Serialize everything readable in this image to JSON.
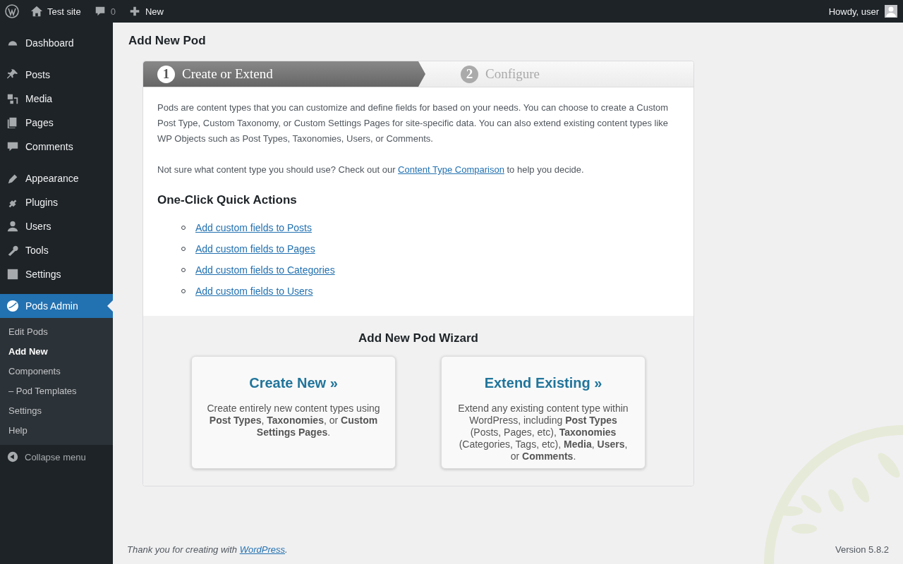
{
  "admin_bar": {
    "site_name": "Test site",
    "comments_count": "0",
    "new_label": "New",
    "greeting": "Howdy, user"
  },
  "sidebar": {
    "groups": [
      [
        {
          "label": "Dashboard",
          "selected": false
        }
      ],
      [
        {
          "label": "Posts",
          "selected": false
        },
        {
          "label": "Media",
          "selected": false
        },
        {
          "label": "Pages",
          "selected": false
        },
        {
          "label": "Comments",
          "selected": false
        }
      ],
      [
        {
          "label": "Appearance",
          "selected": false
        },
        {
          "label": "Plugins",
          "selected": false
        },
        {
          "label": "Users",
          "selected": false
        },
        {
          "label": "Tools",
          "selected": false
        },
        {
          "label": "Settings",
          "selected": false
        }
      ],
      [
        {
          "label": "Pods Admin",
          "selected": true
        }
      ]
    ],
    "submenu": [
      {
        "label": "Edit Pods",
        "selected": false
      },
      {
        "label": "Add New",
        "selected": true
      },
      {
        "label": "Components",
        "selected": false
      },
      {
        "label": "– Pod Templates",
        "selected": false
      },
      {
        "label": "Settings",
        "selected": false
      },
      {
        "label": "Help",
        "selected": false
      }
    ],
    "collapse_label": "Collapse menu"
  },
  "page_title": "Add New Pod",
  "steps": [
    {
      "number": "1",
      "label": "Create or Extend",
      "selected": true
    },
    {
      "number": "2",
      "label": "Configure",
      "selected": false
    }
  ],
  "intro": "Pods are content types that you can customize and define fields for based on your needs. You can choose to create a Custom Post Type, Custom Taxonomy, or Custom Settings Pages for site-specific data. You can also extend existing content types like WP Objects such as Post Types, Taxonomies, Users, or Comments.",
  "help_text": {
    "before": "Not sure what content type you should use? Check out our",
    "link": "Content Type Comparison",
    "after": "to help you decide."
  },
  "quick_actions": {
    "title": "One-Click Quick Actions",
    "links": [
      "Add custom fields to Posts",
      "Add custom fields to Pages",
      "Add custom fields to Categories",
      "Add custom fields to Users"
    ]
  },
  "wizard": {
    "title": "Add New Pod Wizard",
    "options": [
      {
        "title": "Create New »",
        "description": "Create entirely new content types using **Post Types**, **Taxonomies**, or **Custom Settings Pages**."
      },
      {
        "title": "Extend Existing »",
        "description": "Extend any existing content type within WordPress, including **Post Types** (Posts, Pages, etc), **Taxonomies** (Categories, Tags, etc), **Media**, **Users**, or **Comments**."
      }
    ]
  },
  "footer": {
    "before": "Thank you for creating with",
    "link": "WordPress",
    "after": ".",
    "version": "Version 5.8.2"
  }
}
